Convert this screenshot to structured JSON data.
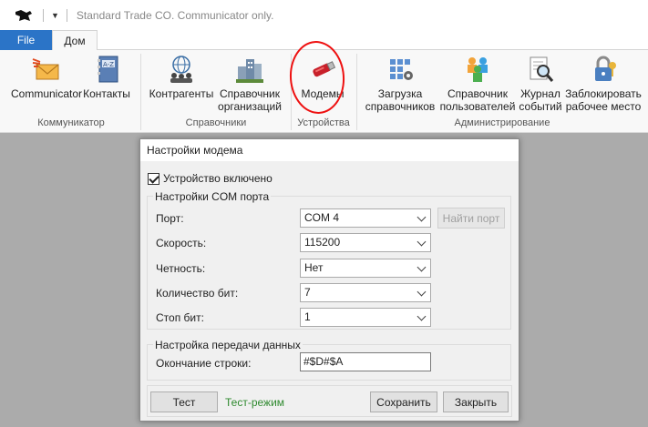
{
  "window": {
    "title": "Standard Trade CO. Communicator only."
  },
  "tabs": [
    {
      "label": "File"
    },
    {
      "label": "Дом"
    }
  ],
  "ribbon": {
    "groups": [
      {
        "label": "Коммуникатор",
        "items": [
          {
            "label": "Communicator",
            "icon": "envelope-icon"
          },
          {
            "label": "Контакты",
            "icon": "address-book-icon"
          }
        ]
      },
      {
        "label": "Справочники",
        "items": [
          {
            "label": "Контрагенты",
            "icon": "globe-people-icon"
          },
          {
            "label1": "Справочник",
            "label2": "организаций",
            "icon": "buildings-icon"
          }
        ]
      },
      {
        "label": "Устройства",
        "items": [
          {
            "label": "Модемы",
            "icon": "usb-modem-icon"
          }
        ]
      },
      {
        "label": "Администрирование",
        "items": [
          {
            "label1": "Загрузка",
            "label2": "справочников",
            "icon": "grid-gear-icon"
          },
          {
            "label1": "Справочник",
            "label2": "пользователей",
            "icon": "users-icon"
          },
          {
            "label1": "Журнал",
            "label2": "событий",
            "icon": "magnifier-doc-icon"
          },
          {
            "label1": "Заблокировать",
            "label2": "рабочее место",
            "icon": "lock-icon"
          }
        ]
      }
    ]
  },
  "dialog": {
    "title": "Настройки модема",
    "enabled_label": "Устройство включено",
    "enabled": true,
    "com_group": {
      "legend": "Настройки COM порта",
      "port_label": "Порт:",
      "port_value": "COM 4",
      "find_port_label": "Найти порт",
      "speed_label": "Скорость:",
      "speed_value": "115200",
      "parity_label": "Четность:",
      "parity_value": "Нет",
      "bits_label": "Количество бит:",
      "bits_value": "7",
      "stop_label": "Стоп бит:",
      "stop_value": "1"
    },
    "data_group": {
      "legend": "Настройка передачи данных",
      "eol_label": "Окончание строки:",
      "eol_value": "#$D#$A"
    },
    "test_button": "Тест",
    "test_mode": "Тест-режим",
    "save_button": "Сохранить",
    "close_button": "Закрыть"
  },
  "colors": {
    "accent": "#2b74c7",
    "annotation": "#e11111",
    "test_mode": "#2f8a2f"
  }
}
